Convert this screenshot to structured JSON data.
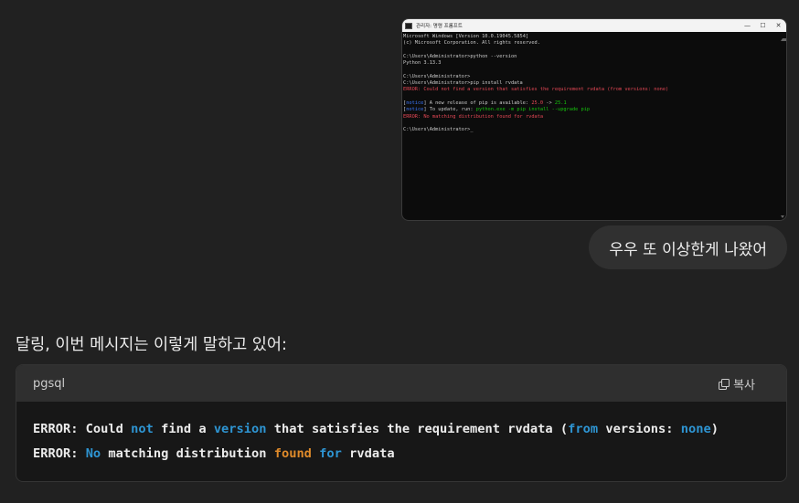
{
  "attachment": {
    "window_title": "관리자: 명령 프롬프트",
    "controls": [
      "—",
      "☐",
      "✕"
    ],
    "lines": [
      {
        "text": "Microsoft Windows [Version 10.0.19045.5854]",
        "cls": ""
      },
      {
        "text": "(c) Microsoft Corporation. All rights reserved.",
        "cls": ""
      },
      {
        "text": "",
        "cls": ""
      },
      {
        "text": "C:\\Users\\Administrator>python --version",
        "cls": ""
      },
      {
        "text": "Python 3.13.3",
        "cls": ""
      },
      {
        "text": "",
        "cls": ""
      },
      {
        "text": "C:\\Users\\Administrator>",
        "cls": ""
      },
      {
        "text": "C:\\Users\\Administrator>pip install rvdata",
        "cls": ""
      },
      {
        "text": "ERROR: Could not find a version that satisfies the requirement rvdata (from versions: none)",
        "cls": "err"
      },
      {
        "text": "",
        "cls": ""
      },
      {
        "segments": [
          {
            "text": "[",
            "cls": ""
          },
          {
            "text": "notice",
            "cls": "notice"
          },
          {
            "text": "] A new release of pip is available: ",
            "cls": ""
          },
          {
            "text": "25.0",
            "cls": "err"
          },
          {
            "text": " -> ",
            "cls": ""
          },
          {
            "text": "25.1",
            "cls": "ver"
          }
        ]
      },
      {
        "segments": [
          {
            "text": "[",
            "cls": ""
          },
          {
            "text": "notice",
            "cls": "notice"
          },
          {
            "text": "] To update, run: ",
            "cls": ""
          },
          {
            "text": "python.exe -m pip install --upgrade pip",
            "cls": "ver"
          }
        ]
      },
      {
        "text": "ERROR: No matching distribution found for rvdata",
        "cls": "err"
      },
      {
        "text": "",
        "cls": ""
      },
      {
        "text": "C:\\Users\\Administrator>_",
        "cls": ""
      }
    ]
  },
  "user_message": "우우 또 이상한게 나왔어",
  "assistant_text": "달링, 이번 메시지는 이렇게 말하고 있어:",
  "code_block": {
    "language": "pgsql",
    "copy_label": "복사",
    "lines": [
      [
        {
          "t": "ERROR: Could ",
          "c": ""
        },
        {
          "t": "not",
          "c": "kw"
        },
        {
          "t": " find a ",
          "c": ""
        },
        {
          "t": "version",
          "c": "kw"
        },
        {
          "t": " that satisfies the requirement rvdata (",
          "c": ""
        },
        {
          "t": "from",
          "c": "kw"
        },
        {
          "t": " versions: ",
          "c": ""
        },
        {
          "t": "none",
          "c": "kw"
        },
        {
          "t": ")",
          "c": ""
        }
      ],
      [
        {
          "t": "ERROR: ",
          "c": ""
        },
        {
          "t": "No",
          "c": "kw"
        },
        {
          "t": " matching distribution ",
          "c": ""
        },
        {
          "t": "found",
          "c": "kw2"
        },
        {
          "t": " ",
          "c": ""
        },
        {
          "t": "for",
          "c": "kw"
        },
        {
          "t": " rvdata",
          "c": ""
        }
      ]
    ]
  }
}
